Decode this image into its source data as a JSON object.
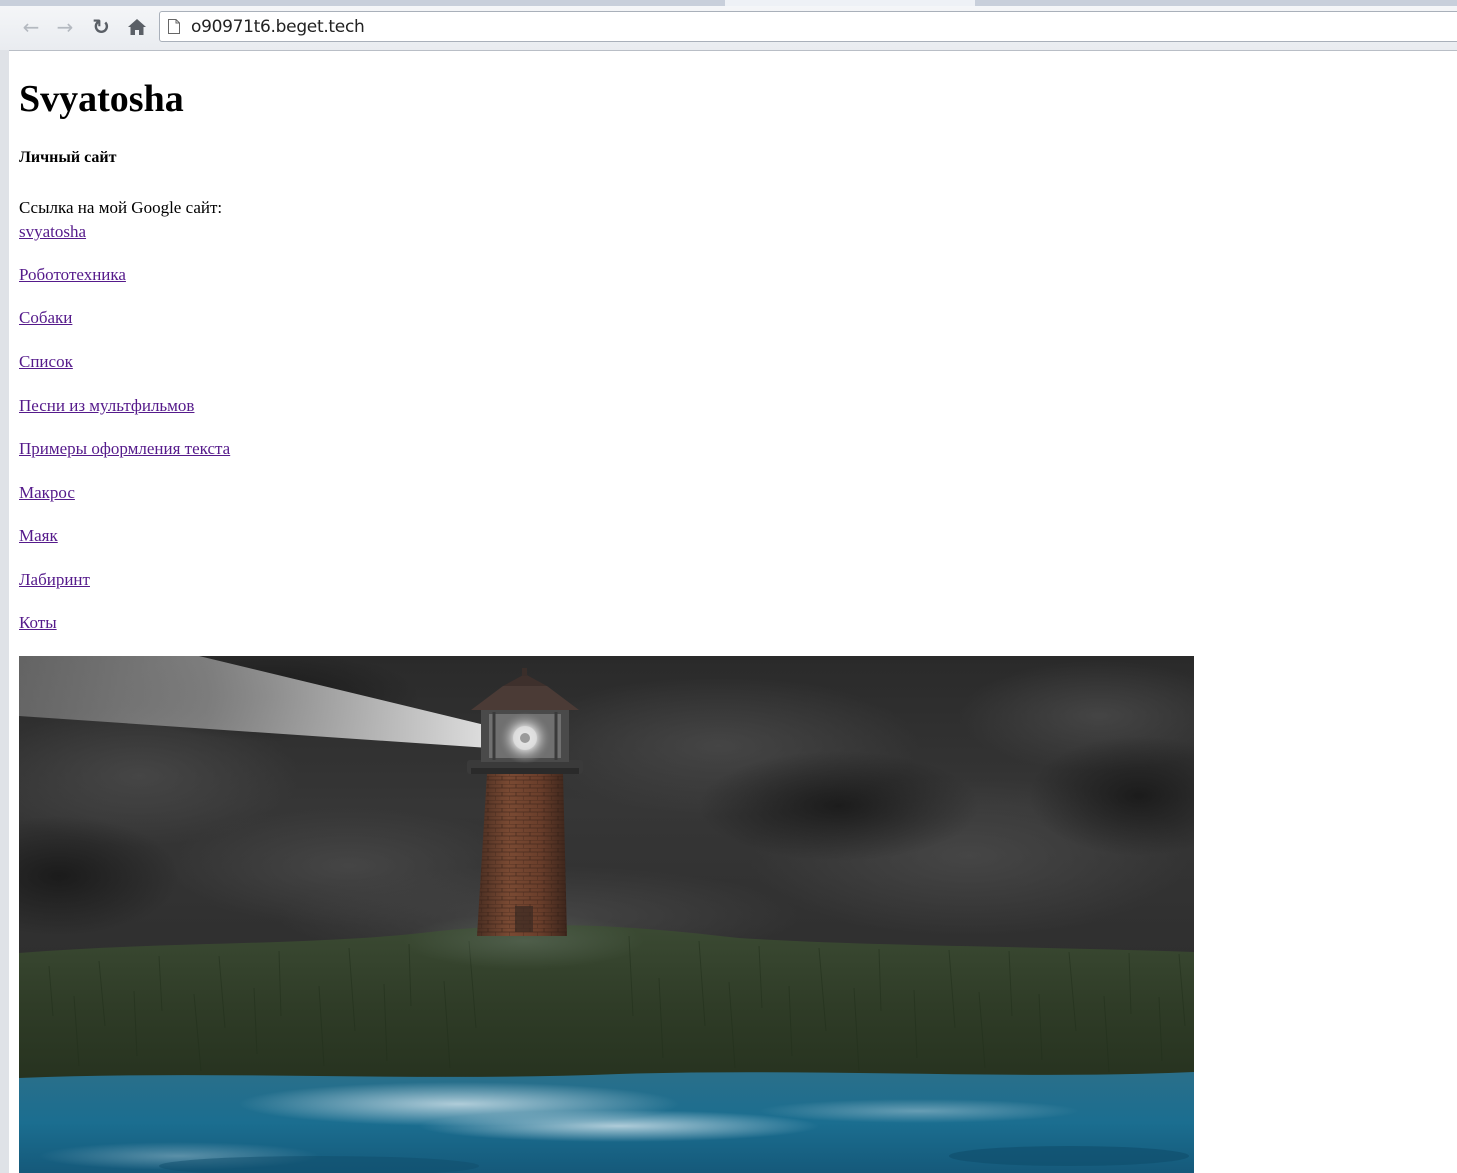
{
  "browser": {
    "url": "o90971t6.beget.tech",
    "back_icon": "back-arrow-icon",
    "forward_icon": "forward-arrow-icon",
    "reload_icon": "reload-icon",
    "home_icon": "home-icon",
    "page_icon": "document-icon"
  },
  "page": {
    "title": "Svyatosha",
    "subtitle": "Личный сайт",
    "google_text": "Ссылка на мой Google сайт:",
    "google_link": "svyatosha",
    "links": [
      "Робототехника",
      "Собаки",
      "Список",
      "Песни из мультфильмов",
      "Примеры оформления текста",
      "Макрос",
      "Маяк",
      "Лабиринт",
      "Коты"
    ],
    "image": "lighthouse at night illustration"
  },
  "colors": {
    "visited_link": "#551a8b",
    "text": "#000000"
  }
}
